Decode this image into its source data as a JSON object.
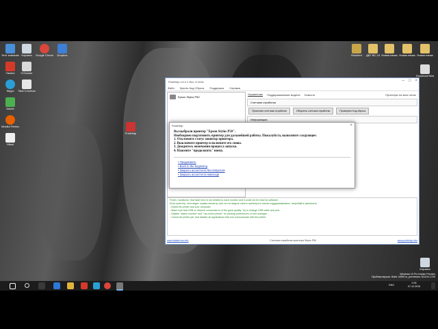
{
  "window": {
    "title": "PrintHelp v.5.0.1 Rev. 5.1016",
    "menu": [
      "Файл",
      "Купить Код Сброса",
      "Поддержка",
      "Справка"
    ],
    "selected_printer": "Epson Stylus P50",
    "tabs": [
      "Управление",
      "Поддерживаемые модели",
      "Новости"
    ],
    "all_printers_label": "Принтеры на всех сетях",
    "counters_label": "Счетчики отработки",
    "btn_read_counters": "Прочитать счетчики отработки",
    "btn_reset_counters": "Обнулить счетчики отработки",
    "btn_check_code": "Проверить Код сброса",
    "info_label": "Информация",
    "update_list_label": "Обновить список принтеров",
    "log_lines": [
      "Finish, monitorice, that fatal error is not related to each monitor and it could not be read by software.",
      "Если принтер, сети видит сервер монитор чем что не видите своего принтера в списке поддерживаемых, попробуйте увеличить.",
      "- Install the printer and your computer.",
      "- Make sure that USB or network connection is of the good quality. Try to change USB cable and port.",
      "- Disable \"status monitor\" and \"my recent printer\" for printing preferences or font manager.",
      "- Cancel all printer job, and disable all applications that can communicate with the printer."
    ],
    "status_left": "www.fatalerrors.info",
    "status_mid": "Счетчики отработки принтера Stylus P50",
    "status_right": "www.printhelp.info"
  },
  "dialog": {
    "title": "PrintHelp",
    "lines": [
      "Вы выбрали принтер \"Epson Stylus P50\".",
      "Необходимо подготовить принтер для дальнейшей работы. Пожалуйста, выполните следующее:",
      "1. Отключите статус монитор принтера.",
      "2. Выключите принтер и включите его снова.",
      "3. Дождитесь окончания процесса запуска.",
      "4. Нажмите \"продолжить\" внизу."
    ],
    "links": [
      "Продолжить",
      "Back to the beginning",
      "Закрыть ассистента без вопросов",
      "Закрыть ассистента навсегда"
    ]
  },
  "desktop": {
    "icons_left": [
      "Этот компьютер",
      "Корзина",
      "Google Chrome",
      "Dropbox",
      "Yandex",
      "CCleaner",
      "Skype",
      "Total Commander",
      "Adobe",
      "Mozilla Firefox",
      "Hikari",
      "PrintHelp"
    ],
    "icons_right": [
      "Resident",
      "ДБУ ВС-15",
      "Новая папка",
      "Новая папка",
      "Новая папка",
      "Download Master"
    ],
    "recycle_label": "Корзина"
  },
  "taskbar": {
    "time": "2:05",
    "date": "07.12.2016",
    "lang": "ENG"
  },
  "watermark": {
    "line1": "Windows 10 Pro Insider Preview",
    "line2": "Пробная версия. Build 14959.rs_prerelease.161104-1700"
  },
  "colors": {
    "window_border": "#7a9cc6",
    "link": "#2244bb",
    "log_text": "#2a8a2a",
    "taskbar": "#1c1c1c"
  }
}
